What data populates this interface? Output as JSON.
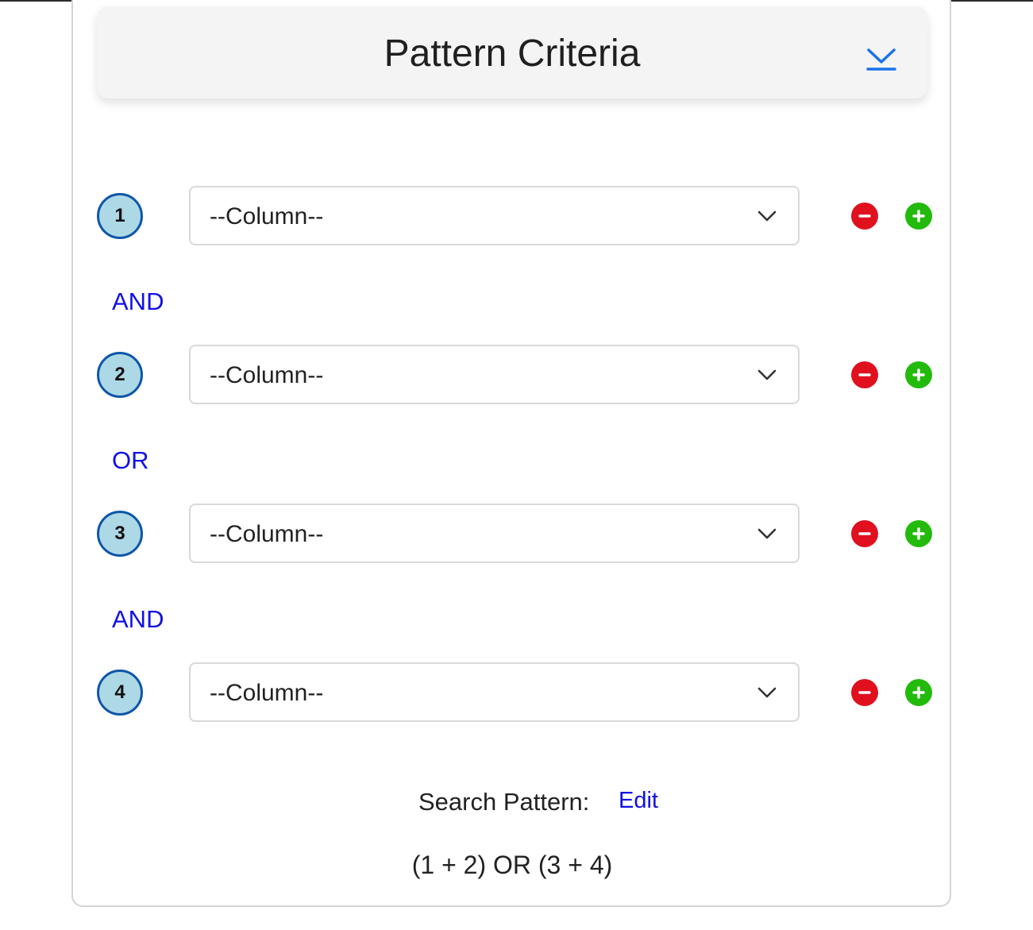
{
  "header": {
    "title": "Pattern Criteria",
    "collapse_icon": "chevron-down-underline-icon"
  },
  "criteria": [
    {
      "number": "1",
      "column_select": "--Column--"
    },
    {
      "number": "2",
      "column_select": "--Column--"
    },
    {
      "number": "3",
      "column_select": "--Column--"
    },
    {
      "number": "4",
      "column_select": "--Column--"
    }
  ],
  "connectors": [
    "AND",
    "OR",
    "AND"
  ],
  "search_pattern": {
    "label": "Search Pattern:",
    "edit_label": "Edit",
    "value": "(1 + 2) OR (3 + 4)"
  },
  "colors": {
    "badge_fill": "#add8e6",
    "badge_border": "#0d55a8",
    "connector_text": "#1010e6",
    "remove_button": "#e0101f",
    "add_button": "#22bb0c",
    "collapse_icon": "#1a73e8"
  }
}
